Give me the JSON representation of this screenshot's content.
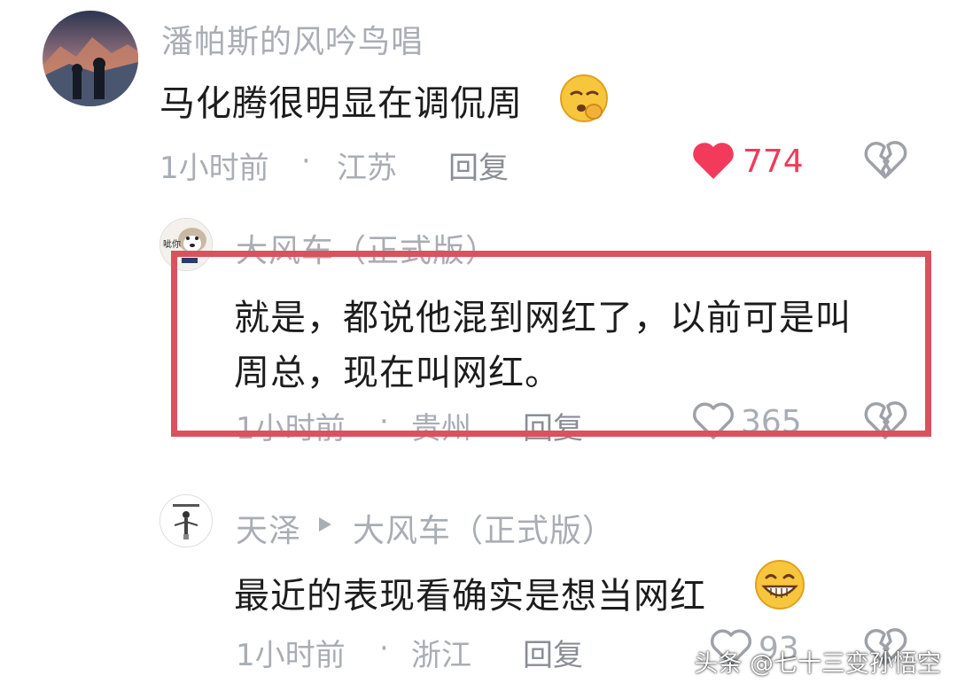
{
  "comments": [
    {
      "username": "潘帕斯的风吟鸟唱",
      "content": "马化腾很明显在调侃周",
      "time": "1小时前",
      "location": "江苏",
      "reply_label": "回复",
      "likes": "774",
      "liked": true,
      "emoji": "shushing-face-emoji"
    },
    {
      "username": "大风车（正式版）",
      "content_line1": "就是，都说他混到网红了，以前可是叫",
      "content_line2": "周总，现在叫网红。",
      "time": "1小时前",
      "location": "贵州",
      "reply_label": "回复",
      "likes": "365",
      "liked": false,
      "avatar_text": "呲你"
    },
    {
      "username": "天泽",
      "reply_to": "大风车（正式版）",
      "content": "最近的表现看确实是想当网红",
      "time": "1小时前",
      "location": "浙江",
      "reply_label": "回复",
      "likes": "93",
      "liked": false,
      "emoji": "grinning-face-emoji"
    }
  ],
  "separator": "·",
  "watermark": "头条 @七十三变孙悟空",
  "colors": {
    "like_active": "#f23a5a",
    "highlight_border": "#d9525e",
    "meta_text": "#a9adb4"
  }
}
